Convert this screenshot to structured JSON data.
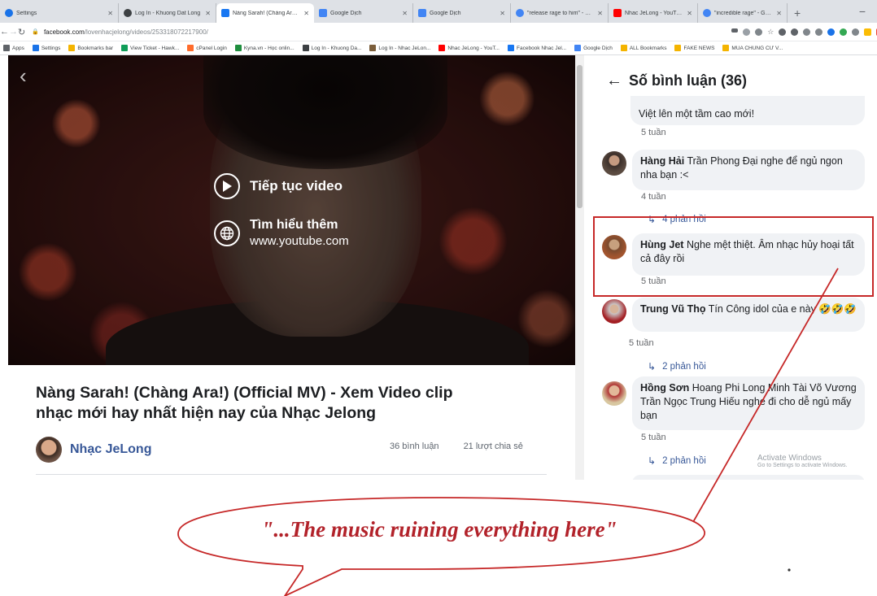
{
  "browser": {
    "tabs": [
      {
        "title": "Settings",
        "color": "#1a73e8",
        "active": false
      },
      {
        "title": "Log In - Khuong Dat Long",
        "color": "#3c4043",
        "active": false
      },
      {
        "title": "Nàng Sarah! (Chàng Ara!) (",
        "color": "#1877f2",
        "active": true
      },
      {
        "title": "Google Dịch",
        "color": "#4285f4",
        "active": false
      },
      {
        "title": "Google Dịch",
        "color": "#4285f4",
        "active": false
      },
      {
        "title": "\"release rage to him\" - Goo",
        "color": "#4285f4",
        "active": false
      },
      {
        "title": "Nhac JeLong - YouTube",
        "color": "#ff0000",
        "active": false
      },
      {
        "title": "\"incredible rage\" - Google",
        "color": "#4285f4",
        "active": false
      }
    ],
    "new_tab_label": "+",
    "minimize_label": "−",
    "url_host": "facebook.com",
    "url_path": "/lovenhacjelong/videos/253318072217900/",
    "bookmarks": [
      {
        "label": "Apps",
        "color": "#5f6368"
      },
      {
        "label": "Settings",
        "color": "#1a73e8"
      },
      {
        "label": "Bookmarks bar",
        "color": "#f4b400"
      },
      {
        "label": "View Ticket - Hawk...",
        "color": "#0f9d58"
      },
      {
        "label": "cPanel Login",
        "color": "#ff6c2c"
      },
      {
        "label": "Kyna.vn - Học onlin...",
        "color": "#1e8e3e"
      },
      {
        "label": "Log In - Khuong Da...",
        "color": "#3c4043"
      },
      {
        "label": "Log In - Nhac JeLon...",
        "color": "#7b5e3b"
      },
      {
        "label": "Nhac JeLong - YouT...",
        "color": "#ff0000"
      },
      {
        "label": "Facebook Nhac Jel...",
        "color": "#1877f2"
      },
      {
        "label": "Google Dịch",
        "color": "#4285f4"
      },
      {
        "label": "ALL Bookmarks",
        "color": "#f4b400"
      },
      {
        "label": "FAKE NEWS",
        "color": "#f4b400"
      },
      {
        "label": "MUA CHUNG CƯ V...",
        "color": "#f4b400"
      }
    ]
  },
  "video": {
    "continue_label": "Tiếp tục video",
    "learn_more_label": "Tìm hiểu thêm",
    "learn_more_url": "www.youtube.com"
  },
  "post": {
    "title": "Nàng Sarah! (Chàng Ara!) (Official MV) - Xem Video clip nhạc mới hay nhất hiện nay của Nhạc Jelong",
    "author": "Nhạc JeLong",
    "comment_count": "36 bình luận",
    "share_count": "21 lượt chia sẻ"
  },
  "comments_panel": {
    "header": "Số bình luận (36)",
    "partial_text": "Việt lên một tầm cao mới!",
    "partial_time": "5 tuần",
    "comments": [
      {
        "author": "Hàng Hải",
        "text": "Trần Phong Đại nghe để ngủ ngon nha bạn :<",
        "time": "4 tuần",
        "replies": "4 phản hồi"
      },
      {
        "author": "Hùng Jet",
        "text": "Nghe mệt thiệt. Âm nhạc hủy hoại tất cả đây rồi",
        "time": "5 tuần",
        "replies": ""
      },
      {
        "author": "Trung Vũ Thọ",
        "text": "Tín Công idol của e này 🤣🤣🤣",
        "time": "5 tuần",
        "replies": "2 phản hồi"
      },
      {
        "author": "Hồng Sơn",
        "text": "Hoang Phi Long Minh Tài Võ Vương Trần Ngọc Trung Hiếu nghe đi cho dễ ngủ mấy bạn",
        "time": "5 tuần",
        "replies": "2 phản hồi"
      }
    ],
    "watermark_title": "Activate Windows",
    "watermark_sub": "Go to Settings to activate Windows."
  },
  "annotation": {
    "quote": "\"...The music ruining everything here\"",
    "color": "#c62828"
  }
}
